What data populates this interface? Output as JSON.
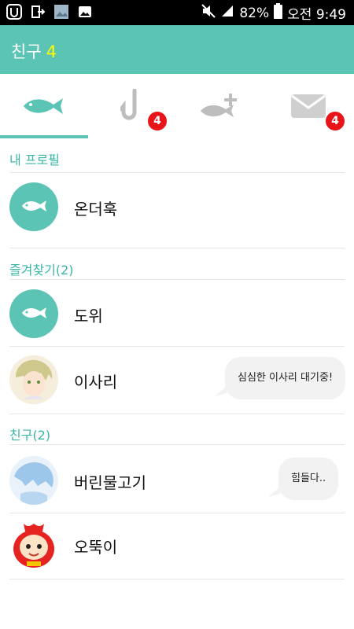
{
  "status_bar": {
    "battery_percent": "82%",
    "clock": "오전 9:49"
  },
  "app_bar": {
    "title": "친구",
    "count": "4"
  },
  "tabs": [
    {
      "icon": "fish-icon",
      "active": true
    },
    {
      "icon": "fishhook-icon",
      "badge": "4"
    },
    {
      "icon": "add-fish-icon"
    },
    {
      "icon": "mail-icon",
      "badge": "4"
    }
  ],
  "sections": {
    "my_profile": "내 프로필",
    "favorites": "즐겨찾기(2)",
    "friends": "친구(2)"
  },
  "my_profile": {
    "name": "온더훅"
  },
  "favorites": [
    {
      "name": "도위"
    },
    {
      "name": "이사리",
      "message": "심심한 이사리 대기중!"
    }
  ],
  "friends": [
    {
      "name": "버린물고기",
      "message": "힘들다.."
    },
    {
      "name": "오뚝이"
    }
  ],
  "colors": {
    "accent": "#5cc4b5",
    "title_count": "#ffff00",
    "badge": "#e8141a",
    "section_text": "#39b6a6"
  }
}
